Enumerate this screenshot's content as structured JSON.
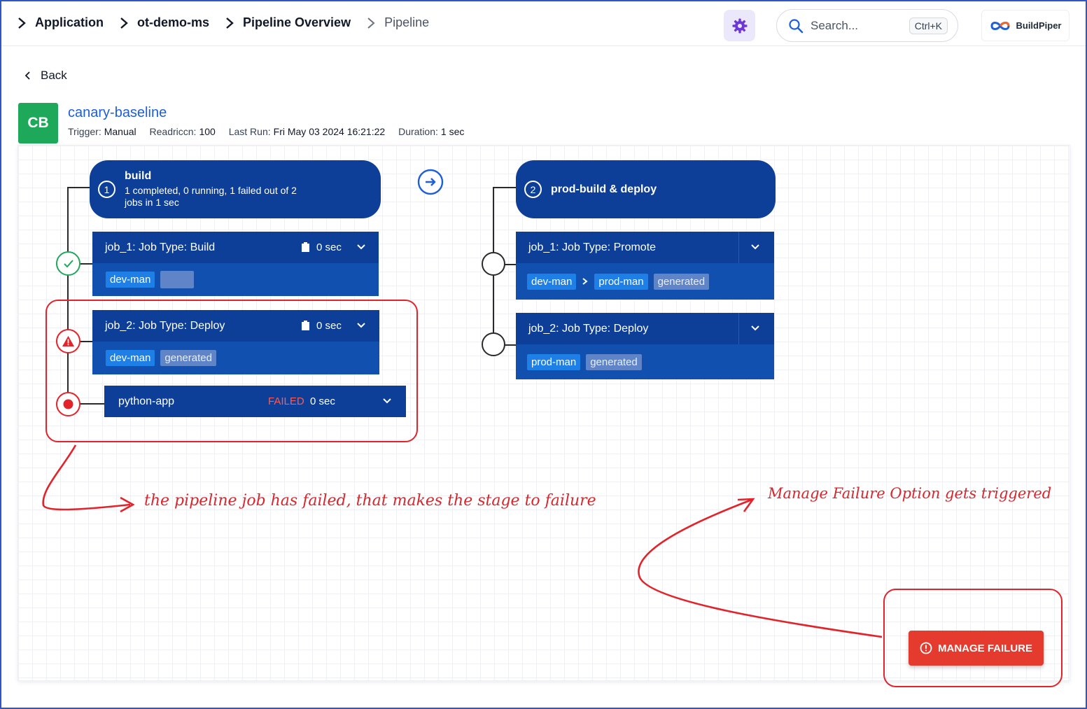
{
  "breadcrumb": {
    "items": [
      "Application",
      "ot-demo-ms",
      "Pipeline Overview"
    ],
    "current": "Pipeline"
  },
  "search": {
    "placeholder": "Search...",
    "shortcut": "Ctrl+K"
  },
  "brand": {
    "name": "BuildPiper"
  },
  "nav": {
    "back_label": "Back"
  },
  "pipeline": {
    "initials": "CB",
    "name": "canary-baseline",
    "meta": [
      {
        "label": "Trigger:",
        "value": "Manual"
      },
      {
        "label": "Readriccn:",
        "value": "100"
      },
      {
        "label": "Last Run:",
        "value": "Fri May 03 2024 16:21:22"
      },
      {
        "label": "Duration:",
        "value": "1 sec"
      }
    ]
  },
  "stages": [
    {
      "number": "1",
      "title": "build",
      "summary": "1 completed, 0 running, 1 failed out of 2 jobs in 1 sec",
      "jobs": [
        {
          "title": "job_1: Job Type: Build",
          "duration": "0 sec",
          "tags": [
            "dev-man",
            ""
          ],
          "status": "success"
        },
        {
          "title": "job_2: Job Type: Deploy",
          "duration": "0 sec",
          "tags": [
            "dev-man",
            "generated"
          ],
          "status": "warning"
        },
        {
          "title": "python-app",
          "status_text": "FAILED",
          "duration": "0 sec",
          "status": "failed"
        }
      ]
    },
    {
      "number": "2",
      "title": "prod-build & deploy",
      "jobs": [
        {
          "title": "job_1: Job Type: Promote",
          "tags": [
            "dev-man",
            "prod-man",
            "generated"
          ]
        },
        {
          "title": "job_2: Job Type: Deploy",
          "tags": [
            "prod-man",
            "generated"
          ]
        }
      ]
    }
  ],
  "actions": {
    "manage_failure": "MANAGE FAILURE"
  },
  "annotations": {
    "job_failed": "the pipeline job has failed, that makes the stage to failure",
    "manage_failure": "Manage Failure Option gets triggered"
  },
  "colors": {
    "stage_bg": "#0d3f98",
    "job_body_bg": "#1250b0",
    "tag_blue": "#1e7fe6",
    "success": "#1ea95a",
    "danger": "#e53a2e",
    "link": "#1d5fd6"
  }
}
